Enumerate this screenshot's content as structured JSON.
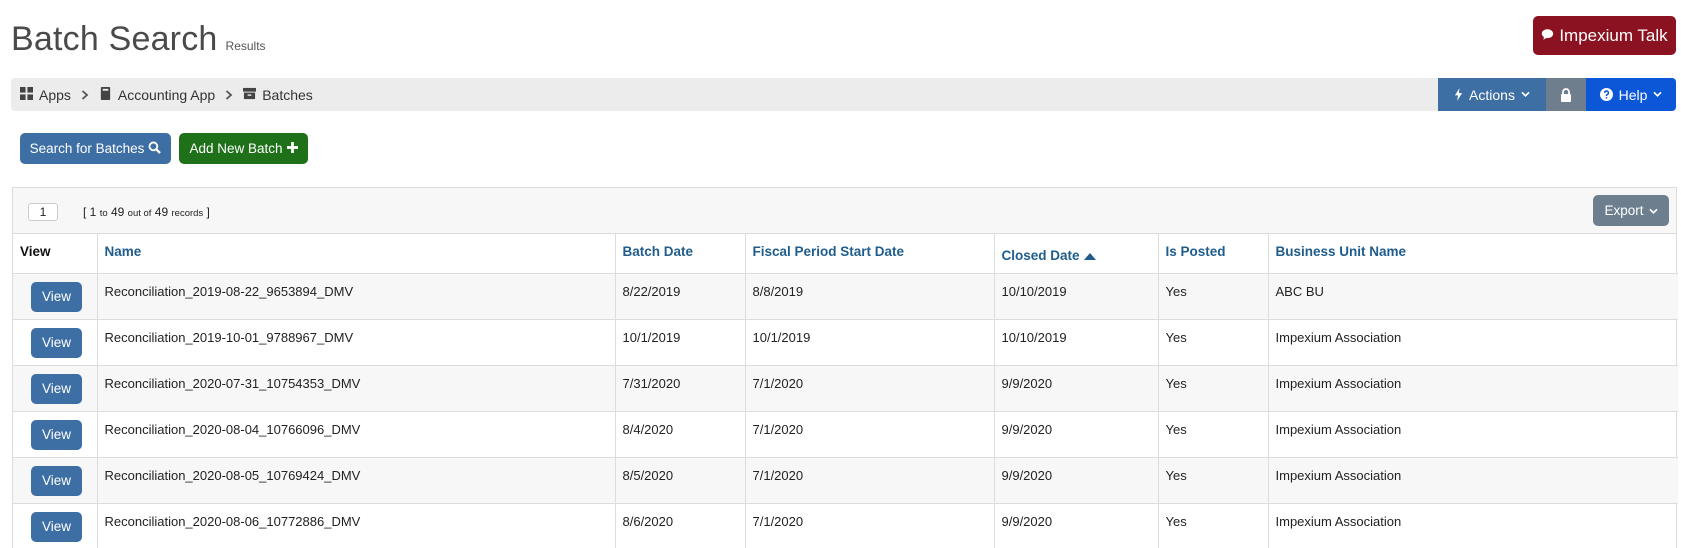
{
  "header": {
    "title": "Batch Search",
    "subtitle": "Results",
    "talk_button": "Impexium Talk"
  },
  "breadcrumb": {
    "items": [
      {
        "label": "Apps",
        "icon": "grid-icon"
      },
      {
        "label": "Accounting App",
        "icon": "book-icon"
      },
      {
        "label": "Batches",
        "icon": "archive-icon"
      }
    ]
  },
  "toolbar": {
    "actions_label": "Actions",
    "help_label": "Help"
  },
  "buttons": {
    "search_batches": "Search for Batches",
    "add_batch": "Add New Batch"
  },
  "pager": {
    "page": "1",
    "range_open": "[ 1",
    "to": "to",
    "count": "49",
    "out_of": "out of",
    "total": "49",
    "records": "records",
    "range_close": "]",
    "export_label": "Export"
  },
  "table": {
    "columns": [
      "View",
      "Name",
      "Batch Date",
      "Fiscal Period Start Date",
      "Closed Date",
      "Is Posted",
      "Business Unit Name"
    ],
    "view_label": "View",
    "rows": [
      {
        "name": "Reconciliation_2019-08-22_9653894_DMV",
        "batch_date": "8/22/2019",
        "fiscal_start": "8/8/2019",
        "closed_date": "10/10/2019",
        "is_posted": "Yes",
        "business_unit": "ABC BU"
      },
      {
        "name": "Reconciliation_2019-10-01_9788967_DMV",
        "batch_date": "10/1/2019",
        "fiscal_start": "10/1/2019",
        "closed_date": "10/10/2019",
        "is_posted": "Yes",
        "business_unit": "Impexium Association"
      },
      {
        "name": "Reconciliation_2020-07-31_10754353_DMV",
        "batch_date": "7/31/2020",
        "fiscal_start": "7/1/2020",
        "closed_date": "9/9/2020",
        "is_posted": "Yes",
        "business_unit": "Impexium Association"
      },
      {
        "name": "Reconciliation_2020-08-04_10766096_DMV",
        "batch_date": "8/4/2020",
        "fiscal_start": "7/1/2020",
        "closed_date": "9/9/2020",
        "is_posted": "Yes",
        "business_unit": "Impexium Association"
      },
      {
        "name": "Reconciliation_2020-08-05_10769424_DMV",
        "batch_date": "8/5/2020",
        "fiscal_start": "7/1/2020",
        "closed_date": "9/9/2020",
        "is_posted": "Yes",
        "business_unit": "Impexium Association"
      },
      {
        "name": "Reconciliation_2020-08-06_10772886_DMV",
        "batch_date": "8/6/2020",
        "fiscal_start": "7/1/2020",
        "closed_date": "9/9/2020",
        "is_posted": "Yes",
        "business_unit": "Impexium Association"
      }
    ]
  },
  "colors": {
    "primary_blue": "#3e6fa4",
    "help_blue": "#0b57d8",
    "talk_red": "#8b1220",
    "add_green": "#1e7019",
    "header_link": "#1f5d8d"
  }
}
